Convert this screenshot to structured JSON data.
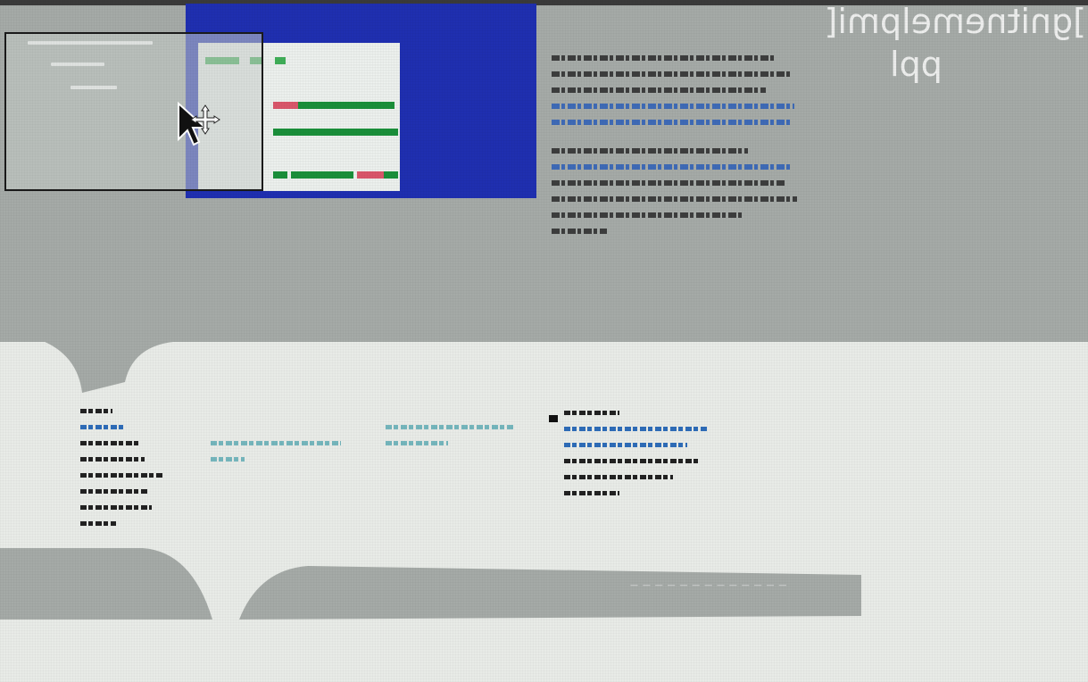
{
  "header": {
    "mirrored_title_line1": "]gnitnemelpmi[",
    "mirrored_title_line2": "ppl"
  },
  "thumbnail": {
    "rows": [
      {
        "colors": [
          "#3fae58",
          "#ffffff",
          "#3fae58",
          "#ffffff",
          "#3fae58"
        ]
      },
      {
        "colors": [
          "#d9566a",
          "#1a8f3a",
          "#1a8f3a"
        ]
      },
      {
        "colors": [
          "#1a8f3a",
          "#1a8f3a",
          "#1a8f3a"
        ]
      },
      {
        "colors": [
          "#1a8f3a",
          "#d9566a",
          "#1a8f3a",
          "#d9566a",
          "#1a8f3a"
        ]
      }
    ]
  },
  "footer": {
    "bar_text": "— — — — — — — — — — — — —"
  },
  "colors": {
    "accent_blue": "#1f2fb0",
    "top_band": "#a5aaa7",
    "page_bg": "#e8ebe7",
    "link_blue": "#2e6cb8",
    "teal": "#58a9b2"
  }
}
